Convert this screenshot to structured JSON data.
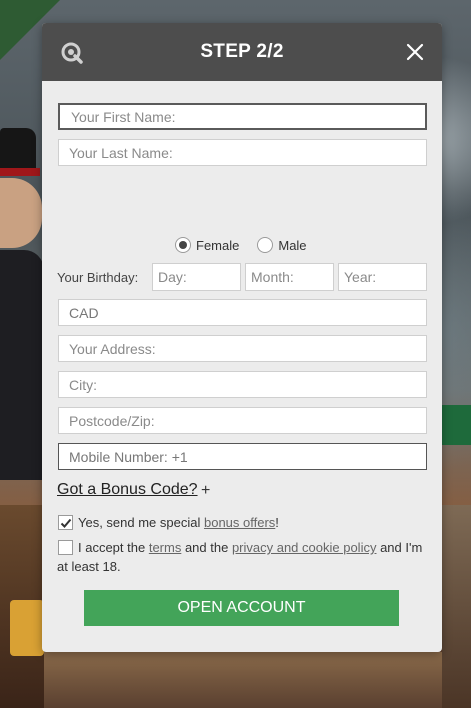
{
  "modal": {
    "title": "STEP 2/2",
    "icons": {
      "logo": "q-logo-icon",
      "close": "close-icon"
    }
  },
  "form": {
    "first_name": {
      "placeholder": "Your First Name:",
      "value": ""
    },
    "last_name": {
      "placeholder": "Your Last Name:",
      "value": ""
    },
    "gender": {
      "options": [
        "Female",
        "Male"
      ],
      "selected": "Female"
    },
    "birthday": {
      "label": "Your Birthday:",
      "day_placeholder": "Day:",
      "month_placeholder": "Month:",
      "year_placeholder": "Year:"
    },
    "currency": {
      "value": "CAD"
    },
    "address": {
      "placeholder": "Your Address:"
    },
    "city": {
      "placeholder": "City:"
    },
    "postcode": {
      "placeholder": "Postcode/Zip:"
    },
    "mobile": {
      "value": "Mobile Number: +1"
    },
    "bonus_code": {
      "label": "Got a Bonus Code?",
      "plus": "+"
    },
    "offers_checkbox": {
      "checked": true,
      "text_before": "Yes, send me special ",
      "link": "bonus offers",
      "text_after": "!"
    },
    "terms_checkbox": {
      "checked": false,
      "text_1": "I accept the ",
      "link_terms": "terms",
      "text_2": " and the ",
      "link_privacy": "privacy and cookie policy",
      "text_3": " and I'm at least 18."
    },
    "submit_label": "OPEN ACCOUNT"
  },
  "colors": {
    "header_bg": "#4d4d4d",
    "modal_bg": "#ececec",
    "button_green": "#43a459"
  }
}
